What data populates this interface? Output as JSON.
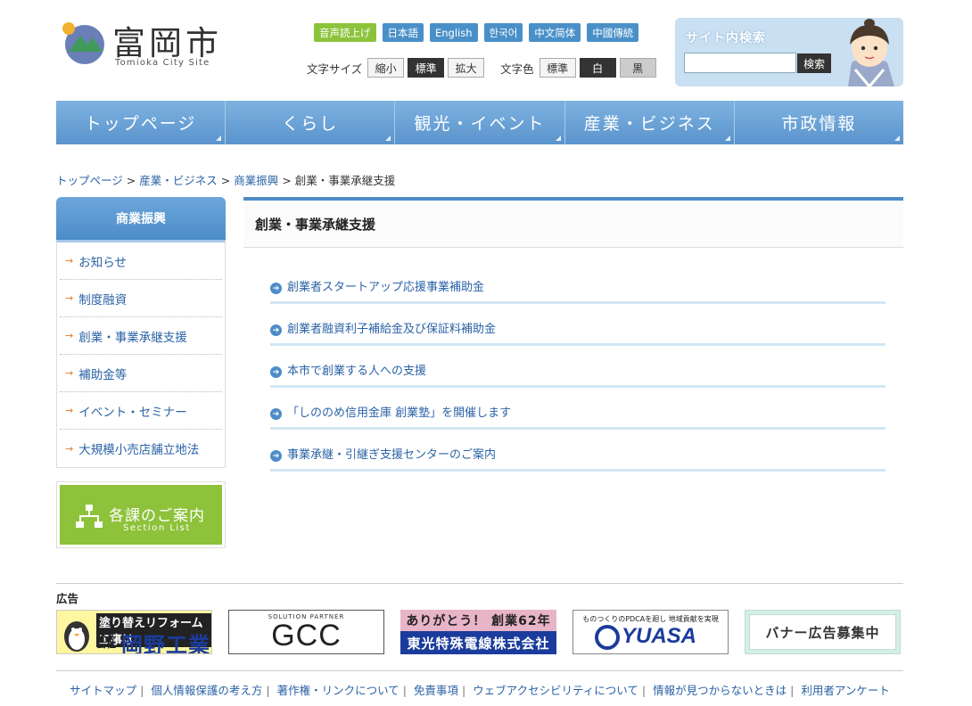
{
  "header": {
    "logo_title": "富岡市",
    "logo_sub": "Tomioka City Site",
    "lang_buttons": [
      "音声読上げ",
      "日本語",
      "English",
      "한국어",
      "中文简体",
      "中國傳統"
    ],
    "font_size_label": "文字サイズ",
    "font_size_options": [
      "縮小",
      "標準",
      "拡大"
    ],
    "color_label": "文字色",
    "color_options": [
      "標準",
      "白",
      "黒"
    ],
    "search_title": "サイト内検索",
    "search_placeholder": "",
    "search_button": "検索"
  },
  "gnav": [
    "トップページ",
    "くらし",
    "観光・イベント",
    "産業・ビジネス",
    "市政情報"
  ],
  "breadcrumb": {
    "items": [
      "トップページ",
      "産業・ビジネス",
      "商業振興"
    ],
    "current": "創業・事業承継支援",
    "sep": ">"
  },
  "sidebar": {
    "heading": "商業振興",
    "items": [
      "お知らせ",
      "制度融資",
      "創業・事業承継支援",
      "補助金等",
      "イベント・セミナー",
      "大規模小売店舗立地法"
    ],
    "section_banner": {
      "title": "各課のご案内",
      "sub": "Section List"
    }
  },
  "main": {
    "title": "創業・事業承継支援",
    "links": [
      "創業者スタートアップ応援事業補助金",
      "創業者融資利子補給金及び保証料補助金",
      "本市で創業する人への支援",
      "「しののめ信用金庫 創業塾」を開催します",
      "事業承継・引継ぎ支援センターのご案内"
    ]
  },
  "ads": {
    "label": "広告",
    "ad1": {
      "line1": "塗り替えリフォーム工事は",
      "line2a": "株式",
      "line2b": "会社",
      "name": "岡野工業"
    },
    "ad2": {
      "small": "SOLUTION PARTNER",
      "name": "GCC"
    },
    "ad3": {
      "line1": "ありがとう！ 創業62年",
      "line2": "東光特殊電線株式会社"
    },
    "ad4": {
      "line1": "ものつくりのPDCAを廻し 地域貢献を実現",
      "name": "YUASA"
    },
    "ad5": {
      "text": "バナー広告募集中"
    }
  },
  "footer": {
    "links": [
      "サイトマップ",
      "個人情報保護の考え方",
      "著作権・リンクについて",
      "免責事項",
      "ウェブアクセシビリティについて",
      "情報が見つからないときは",
      "利用者アンケート"
    ]
  },
  "colors": {
    "nav_blue": "#5a94cd",
    "voice_green": "#8cc33c",
    "link_blue": "#2b63a6",
    "section_green": "#8dc23a"
  }
}
